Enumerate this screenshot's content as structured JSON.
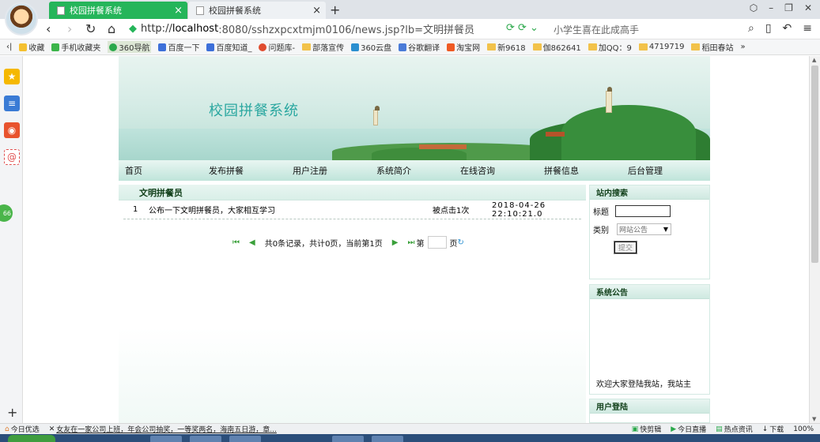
{
  "browser": {
    "tabs": [
      {
        "label": "校园拼餐系统",
        "close": "×"
      },
      {
        "label": "校园拼餐系统",
        "close": "×"
      }
    ],
    "new_tab": "+",
    "url": {
      "scheme": "http://",
      "host": "localhost",
      "rest": ":8080/sshzxpcxtmjm0106/news.jsp?lb=文明拼餐员"
    },
    "address_hint": "小学生喜在此成高手",
    "bookmarks": [
      "收藏",
      "手机收藏夹",
      "360导航",
      "百度一下",
      "百度知道_",
      "问题库-",
      "部落宣传",
      "360云盘",
      "谷歌翻译",
      "淘宝网",
      "新9618",
      "伽862641",
      "加QQ：9",
      "4719719",
      "稻田春站"
    ],
    "bookmark_more": "»"
  },
  "site": {
    "title": "校园拼餐系统",
    "menu": [
      "首页",
      "发布拼餐",
      "用户注册",
      "系统简介",
      "在线咨询",
      "拼餐信息",
      "后台管理"
    ],
    "section_title": "文明拼餐员",
    "news": [
      {
        "idx": "1",
        "title": "公布一下文明拼餐员，大家相互学习",
        "hits": "被点击1次",
        "date": "2018-04-26 22:10:21.0"
      }
    ],
    "pager": {
      "first": "⏮",
      "prev": "◀",
      "info": "共0条记录，共计0页，当前第1页",
      "next": "▶",
      "last": "⏭",
      "page_label": "第",
      "page_suffix": "页"
    },
    "search": {
      "heading": "站内搜索",
      "title_label": "标题",
      "type_label": "类别",
      "type_selected": "网站公告",
      "submit": "提交"
    },
    "notice": {
      "heading": "系统公告",
      "marquee": "欢迎大家登陆我站，我站主"
    },
    "login": {
      "heading": "用户登陆"
    }
  },
  "statusbar": {
    "left": [
      "今日优选",
      "女友在一家公司上班，年会公司抽奖，一等奖两名，海南五日游，章..."
    ],
    "right": [
      "快剪辑",
      "今日直播",
      "热点资讯",
      "下载",
      "100%"
    ]
  }
}
